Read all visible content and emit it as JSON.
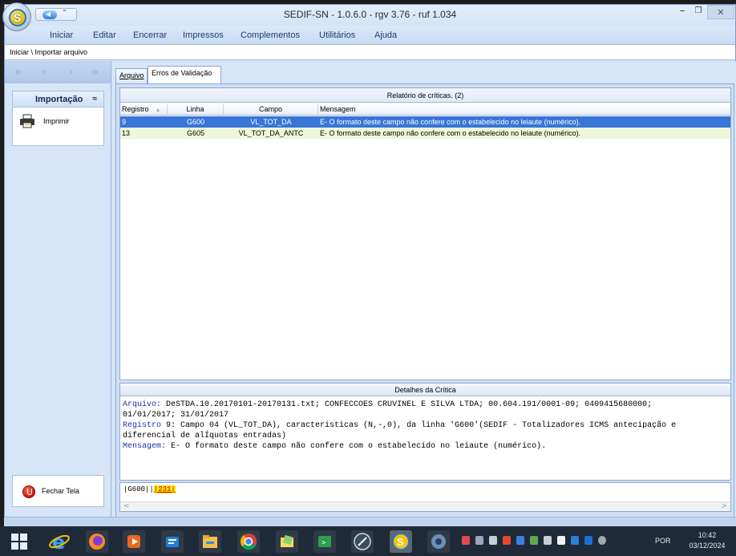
{
  "window": {
    "title": "SEDIF-SN - 1.0.6.0 - rgv 3.76 - ruf 1.034",
    "minimize": "–",
    "restore": "❐",
    "close": "✕",
    "qa_more": "⁼"
  },
  "menu": {
    "items": [
      "Iniciar",
      "Editar",
      "Encerrar",
      "Impressos",
      "Complementos",
      "Utilitários",
      "Ajuda"
    ]
  },
  "breadcrumb": "Iniciar \\ Importar arquivo",
  "nav": {
    "first": "«",
    "prev": "‹",
    "next": "›",
    "last": "»"
  },
  "sidebar": {
    "group_title": "Importação",
    "group_chevron": "≈",
    "print_label": "Imprimir",
    "close_label": "Fechar Tela"
  },
  "tabs": [
    {
      "label": "Arquivo",
      "active": false
    },
    {
      "label": "Erros de Validação",
      "active": true
    }
  ],
  "report": {
    "title": "Relatório de críticas. (2)",
    "columns": [
      "Registro",
      "Linha",
      "Campo",
      "Mensagem"
    ],
    "rows": [
      {
        "registro": "9",
        "linha": "G600",
        "campo": "VL_TOT_DA",
        "mensagem": "E- O formato deste campo não confere com o estabelecido no leiaute (numérico).",
        "selected": true
      },
      {
        "registro": "13",
        "linha": "G605",
        "campo": "VL_TOT_DA_ANTC",
        "mensagem": "E- O formato deste campo não confere com o estabelecido no leiaute (numérico).",
        "selected": false
      }
    ]
  },
  "details": {
    "title": "Detalhes da Crítica",
    "arquivo_label": "Arquivo:",
    "arquivo_line1": " DeSTDA.10.20170101-20170131.txt; CONFECCOES CRUVINEL E SILVA LTDA; 00.604.191/0001-09; 0409415680000;",
    "arquivo_line2": "01/01/2017; 31/01/2017",
    "registro_label": "Registro",
    "registro_line1": " 9: Campo 04 (VL_TOT_DA), caracteristicas (N,-,0), da linha 'G600'(SEDIF - Totalizadores ICMS antecipação e",
    "registro_line2": "diferencial de alÍquotas entradas)",
    "mensagem_label": "Mensagem:",
    "mensagem_text": " E- O formato deste campo não confere com o estabelecido no leiaute (numérico)."
  },
  "raw_line": {
    "prefix": "|G600||",
    "highlight": "|231|",
    "left_arrow": "<",
    "right_arrow": ">"
  },
  "taskbar": {
    "lang": "POR",
    "time": "10:42",
    "date": "03/12/2024"
  },
  "colors": {
    "selected_row": "#3875d7",
    "alt_row": "#eef7d9",
    "label_blue": "#1a33b0",
    "highlight_yellow": "#ffe600"
  }
}
